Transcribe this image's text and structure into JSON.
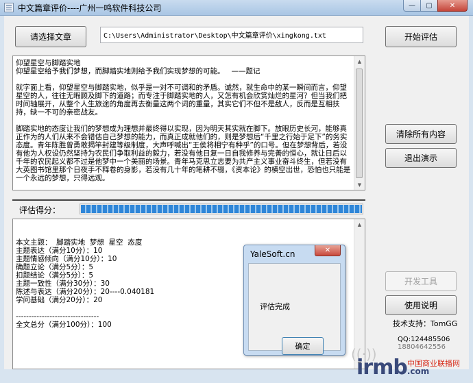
{
  "window": {
    "title": "中文篇章评价----广州一鸣软件科技公司",
    "min_glyph": "—",
    "max_glyph": "▢",
    "close_glyph": "✕"
  },
  "toolbar": {
    "select_article_label": "请选择文章",
    "file_path": "C:\\Users\\Administrator\\Desktop\\中文篇章评价\\xingkong.txt",
    "start_eval_label": "开始评估",
    "clear_all_label": "清除所有内容",
    "exit_demo_label": "退出演示",
    "dev_tools_label": "开发工具",
    "help_label": "使用说明"
  },
  "article": {
    "text": "仰望星空与脚踏实地\n仰望星空给予我们梦想，而脚踏实地则给予我们实现梦想的可能。   ——题记\n\n就字面上看，仰望星空与脚踏实地，似乎是一对不可调和的矛盾。诚然，就生命中的某一瞬间而言，仰望星空的人，往往无暇顾及脚下的道路；而专注于脚踏实地的人，又怎有机会欣赏灿烂的星河？但当我们把时间轴展开，从整个人生旅途的角度再去衡量这两个词的重量，其实它们不但不是敌人，反而是互相扶持，缺一不可的亲密战友。\n\n脚踏实地的态度让我们的梦想成为理想并最终得以实现，因为明天其实就在脚下。放眼历史长河，能够真正作为的人们从来不会错估自己梦想的能力，而真正成就他们的，则是梦想后“千里之行始于足下”的务实态度。青年陈胜曾勇敢揭竿封建等级制度，大声呼喊出“王侯将相宁有种乎”的口号。但在梦想背后，若没有他为人权设仍然坚持为农民们争取利益的毅力，若没有他日复一日自我修养与完善的恒心，就让日后以千年的农民起义都不过是他梦中一个美丽的场景。青年马克思立志要为共产主义事业奋斗终生，但若没有大英图书馆里那个日夜手不释卷的身影，若没有几十年的笔耕不辍，《资本论》的横空出世，恐怕也只能是一个永远的梦想，只得远观。"
  },
  "score": {
    "label": "评估得分：",
    "progress_fraction": 1.0
  },
  "result": {
    "text": "\n\n本文主题：  脚踏实地  梦想  星空  态度\n主题表达（满分10分）：10\n主题情感倾向（满分10分）：10\n确题立论（满分5分）：5\n扣题结论（满分5分）：5\n主题一致性（满分30分）：30\n陈述与表达（满分20分）：20----0.040181\n学问基础（满分20分）：20\n\n--------------------------------\n全文总分（满分100分）：100"
  },
  "support": {
    "tech_support": "技术支持：TomGG",
    "qq": "QQ:124485506",
    "phone": "18804642556"
  },
  "dialog": {
    "title": "YaleSoft.cn",
    "message": "评估完成",
    "ok_label": "确定",
    "close_glyph": "✕"
  },
  "watermark": {
    "symbol": "((·))",
    "brand": "irmb",
    "brand_suffix": ".com",
    "site_text": "中国商业联播网"
  }
}
